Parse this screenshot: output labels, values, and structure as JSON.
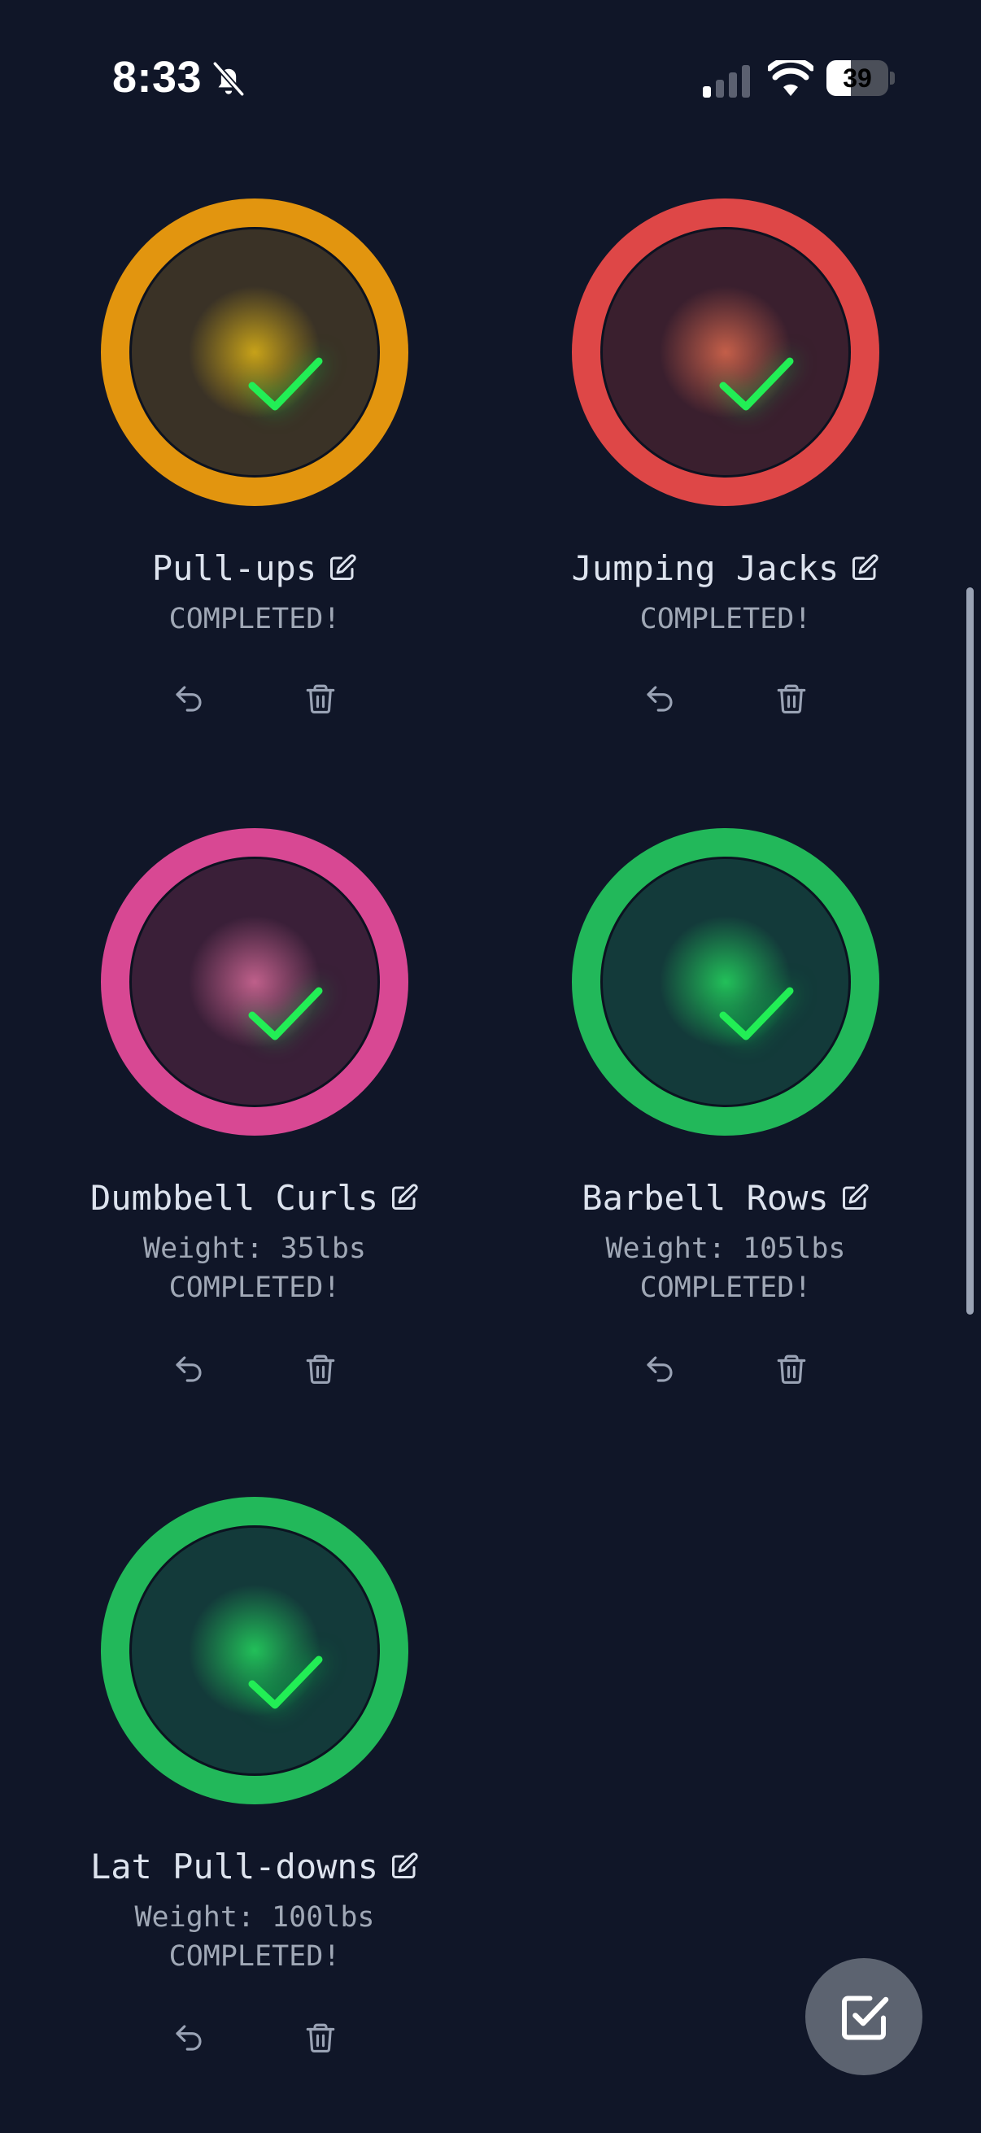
{
  "status_bar": {
    "time": "8:33",
    "battery": "39",
    "battery_level": 0.39
  },
  "exercises": [
    {
      "name": "Pull-ups",
      "weight": "",
      "status": "COMPLETED!",
      "ring_color": "#e2950f",
      "inner_color": "#3a3226"
    },
    {
      "name": "Jumping Jacks",
      "weight": "",
      "status": "COMPLETED!",
      "ring_color": "#de4747",
      "inner_color": "#3a1f2e"
    },
    {
      "name": "Dumbbell Curls",
      "weight": "Weight: 35lbs",
      "status": "COMPLETED!",
      "ring_color": "#d84893",
      "inner_color": "#3a1f38"
    },
    {
      "name": "Barbell Rows",
      "weight": "Weight: 105lbs",
      "status": "COMPLETED!",
      "ring_color": "#22b85a",
      "inner_color": "#133a3a"
    },
    {
      "name": "Lat Pull-downs",
      "weight": "Weight: 100lbs",
      "status": "COMPLETED!",
      "ring_color": "#22b85a",
      "inner_color": "#133a3a"
    }
  ],
  "colors": {
    "background": "#101628",
    "check": "#22ee55",
    "text": "#dde3ee",
    "muted_text": "#a0a8b6",
    "icon": "#9aa3b5",
    "fab": "#5c6370"
  }
}
